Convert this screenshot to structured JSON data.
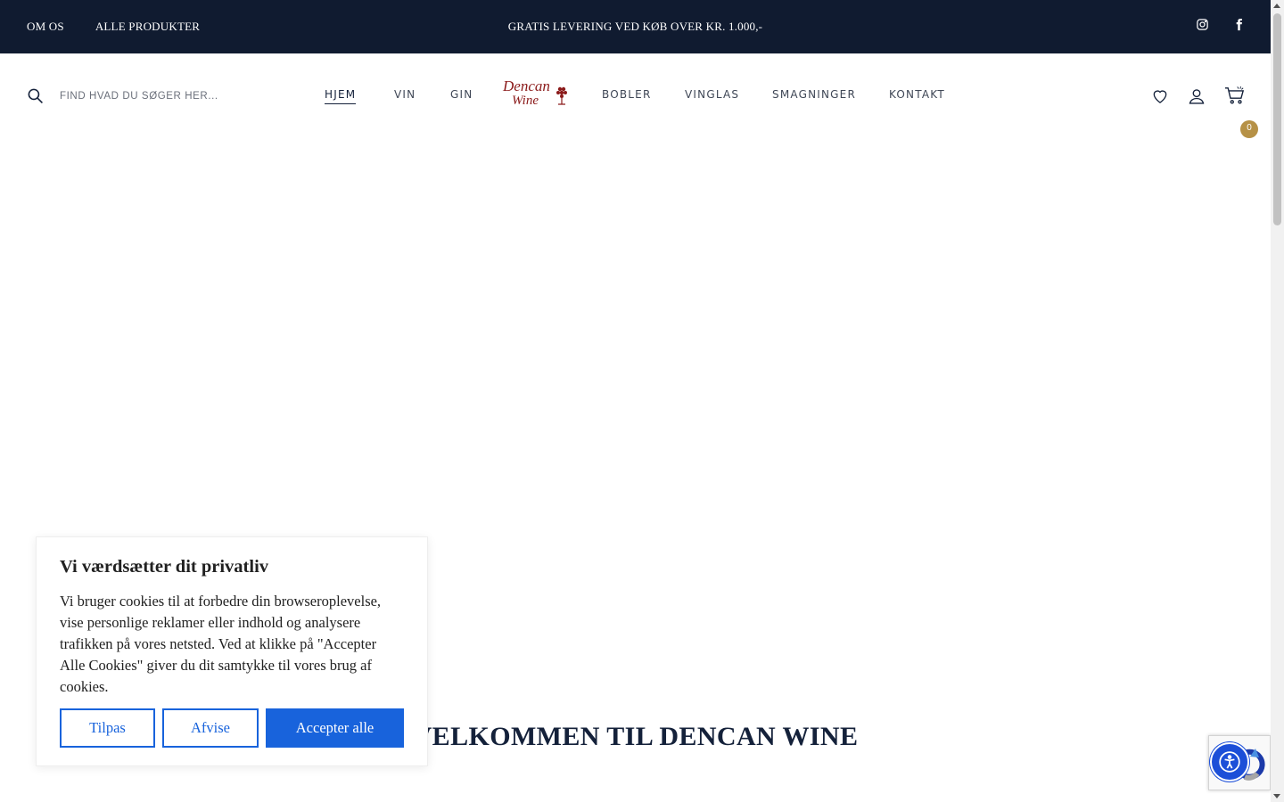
{
  "topbar": {
    "links": [
      "OM OS",
      "ALLE PRODUKTER"
    ],
    "promo": "GRATIS LEVERING VED KØB OVER KR. 1.000,-",
    "social_icons": [
      "instagram-icon",
      "facebook-icon"
    ]
  },
  "header": {
    "search_placeholder": "FIND HVAD DU SØGER HER...",
    "nav": {
      "home": "HJEM",
      "wine": "VIN",
      "gin": "GIN",
      "bubbles": "BOBLER",
      "glasses": "VINGLAS",
      "tastings": "SMAGNINGER",
      "contact": "KONTAKT"
    },
    "active_nav": "HJEM",
    "logo_text": [
      "Dencan",
      "Wine"
    ],
    "icons": [
      "heart-icon",
      "user-icon",
      "cart-icon"
    ],
    "cart_count": "0"
  },
  "main": {
    "welcome_heading": "VELKOMMEN TIL DENCAN WINE"
  },
  "cookie_banner": {
    "title": "Vi værdsætter dit privatliv",
    "body": "Vi bruger cookies til at forbedre din browseroplevelse, vise personlige reklamer eller indhold og analysere trafikken på vores netsted. Ved at klikke på \"Accepter Alle Cookies\" giver du dit samtykke til vores brug af cookies.",
    "customize_label": "Tilpas",
    "reject_label": "Afvise",
    "accept_label": "Accepter alle"
  },
  "colors": {
    "topbar_bg": "#101b30",
    "accent_gold": "#b69146",
    "cookie_blue": "#1863dc",
    "logo_red": "#8b1a1a"
  }
}
